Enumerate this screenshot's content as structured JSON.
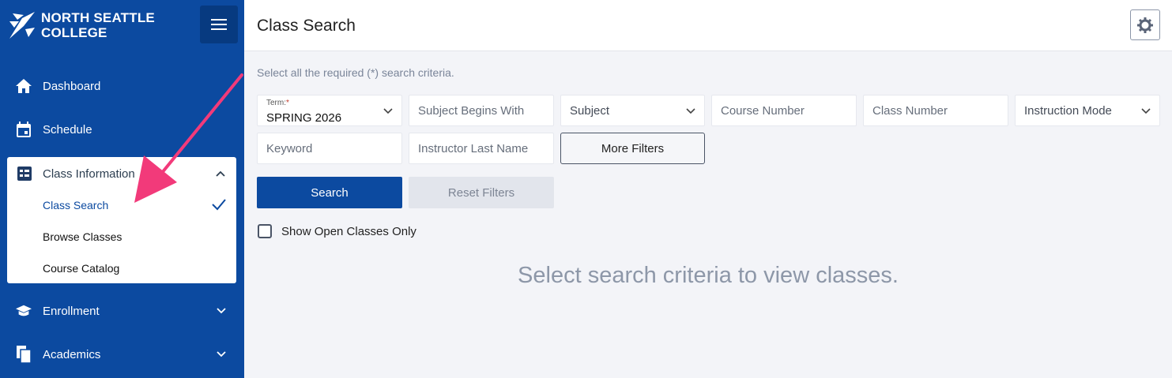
{
  "sidebar": {
    "logo": {
      "line1": "NORTH SEATTLE",
      "line2": "COLLEGE"
    },
    "menu_icon": "hamburger-icon",
    "items": [
      {
        "label": "Dashboard",
        "icon": "home-icon"
      },
      {
        "label": "Schedule",
        "icon": "calendar-icon"
      },
      {
        "label": "Class Information",
        "icon": "list-icon",
        "expanded": true,
        "subitems": [
          {
            "label": "Class Search",
            "active": true
          },
          {
            "label": "Browse Classes"
          },
          {
            "label": "Course Catalog"
          }
        ]
      },
      {
        "label": "Enrollment",
        "icon": "graduation-cap-icon"
      },
      {
        "label": "Academics",
        "icon": "documents-icon"
      }
    ]
  },
  "header": {
    "title": "Class Search",
    "settings_icon": "gear-icon"
  },
  "search": {
    "instructions": "Select all the required (*) search criteria.",
    "term": {
      "label": "Term:",
      "required_mark": "*",
      "value": "SPRING 2026"
    },
    "subject_begins_with": {
      "placeholder": "Subject Begins With"
    },
    "subject": {
      "label": "Subject"
    },
    "course_number": {
      "placeholder": "Course Number"
    },
    "class_number": {
      "placeholder": "Class Number"
    },
    "instruction_mode": {
      "label": "Instruction Mode"
    },
    "keyword": {
      "placeholder": "Keyword"
    },
    "instructor_last_name": {
      "placeholder": "Instructor Last Name"
    },
    "more_filters_label": "More Filters",
    "search_label": "Search",
    "reset_label": "Reset Filters",
    "open_classes_label": "Show Open Classes Only",
    "open_classes_checked": false
  },
  "results": {
    "empty_message": "Select search criteria to view classes."
  },
  "colors": {
    "brand": "#0c4aa0",
    "annotation_arrow": "#f23a7a"
  }
}
